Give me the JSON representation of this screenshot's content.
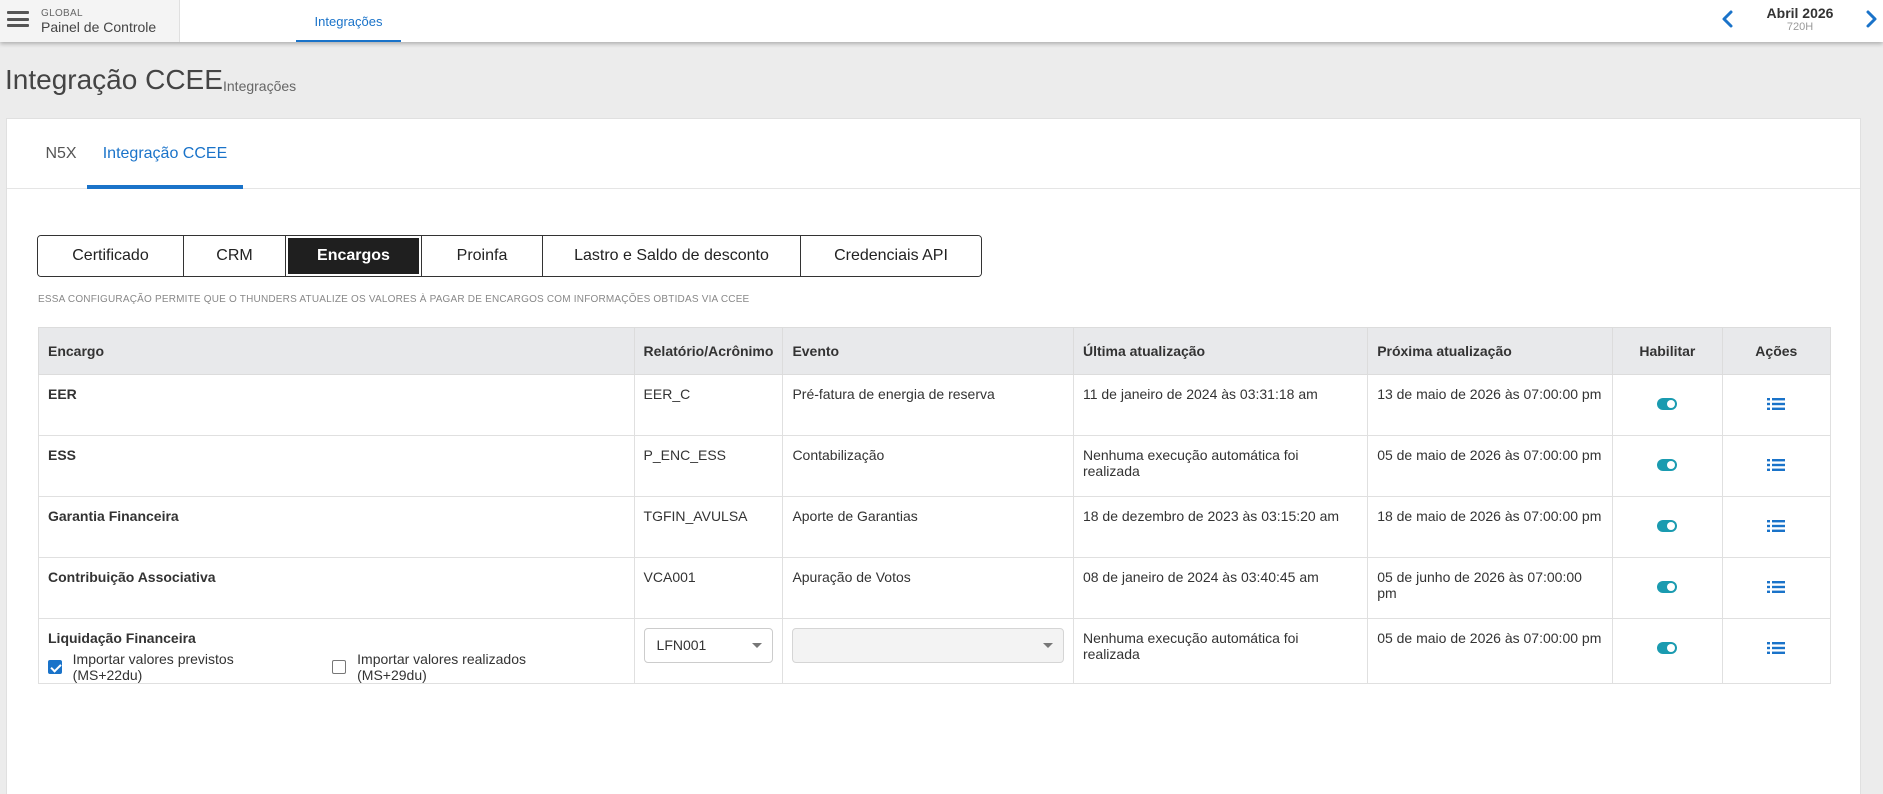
{
  "topbar": {
    "scope_label": "GLOBAL",
    "app_title": "Painel de Controle",
    "active_tab": "Integrações",
    "period": {
      "month": "Abril 2026",
      "hours": "720H"
    }
  },
  "page": {
    "title": "Integração CCEE",
    "subtitle": "Integrações"
  },
  "panel_tabs": [
    {
      "label": "N5X",
      "active": false
    },
    {
      "label": "Integração CCEE",
      "active": true
    }
  ],
  "segments": [
    {
      "label": "Certificado",
      "active": false
    },
    {
      "label": "CRM",
      "active": false
    },
    {
      "label": "Encargos",
      "active": true
    },
    {
      "label": "Proinfa",
      "active": false
    },
    {
      "label": "Lastro e Saldo de desconto",
      "active": false
    },
    {
      "label": "Credenciais API",
      "active": false
    }
  ],
  "info_text": "ESSA CONFIGURAÇÃO PERMITE QUE O THUNDERS ATUALIZE OS VALORES À PAGAR DE ENCARGOS COM INFORMAÇÕES OBTIDAS VIA CCEE",
  "table": {
    "headers": [
      "Encargo",
      "Relatório/Acrônimo",
      "Evento",
      "Última atualização",
      "Próxima atualização",
      "Habilitar",
      "Ações"
    ],
    "rows": [
      {
        "encargo": "EER",
        "relatorio": "EER_C",
        "evento": "Pré-fatura de energia de reserva",
        "ultima": "11 de janeiro de 2024 às 03:31:18 am",
        "proxima": "13 de maio de 2026 às 07:00:00 pm",
        "habilitar": true
      },
      {
        "encargo": "ESS",
        "relatorio": "P_ENC_ESS",
        "evento": "Contabilização",
        "ultima": "Nenhuma execução automática foi realizada",
        "proxima": "05 de maio de 2026 às 07:00:00 pm",
        "habilitar": true
      },
      {
        "encargo": "Garantia Financeira",
        "relatorio": "TGFIN_AVULSA",
        "evento": "Aporte de Garantias",
        "ultima": "18 de dezembro de 2023 às 03:15:20 am",
        "proxima": "18 de maio de 2026 às 07:00:00 pm",
        "habilitar": true
      },
      {
        "encargo": "Contribuição Associativa",
        "relatorio": "VCA001",
        "evento": "Apuração de Votos",
        "ultima": "08 de janeiro de 2024 às 03:40:45 am",
        "proxima": "05 de junho de 2026 às 07:00:00 pm",
        "habilitar": true
      }
    ],
    "last_row": {
      "encargo": "Liquidação Financeira",
      "check_previstos": {
        "label": "Importar valores previstos (MS+22du)",
        "checked": true
      },
      "check_realizados": {
        "label": "Importar valores realizados (MS+29du)",
        "checked": false
      },
      "relatorio_select": "LFN001",
      "evento_select": "",
      "ultima": "Nenhuma execução automática foi realizada",
      "proxima": "05 de maio de 2026 às 07:00:00 pm",
      "habilitar": true
    }
  },
  "colors": {
    "accent": "#1a73c9",
    "toggle": "#1a9bb0",
    "segment_active": "#1f1f1f"
  }
}
